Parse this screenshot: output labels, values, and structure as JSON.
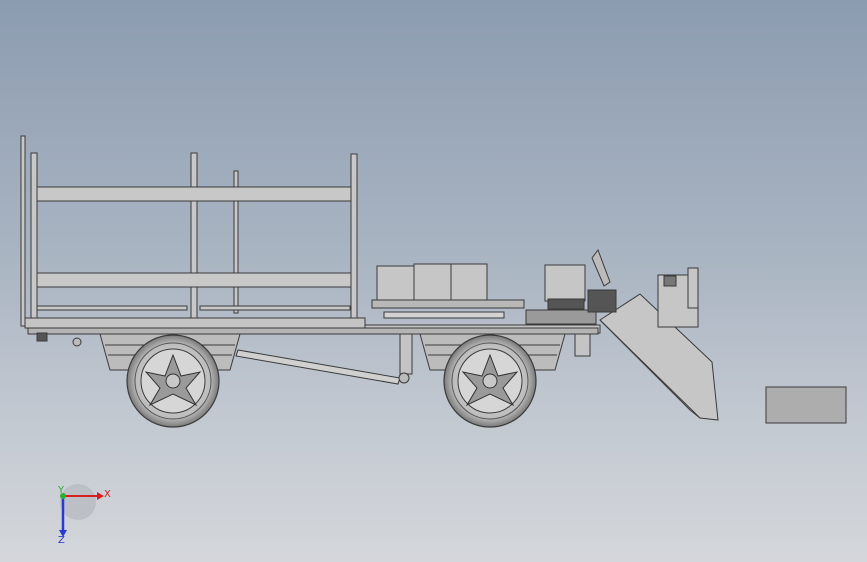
{
  "viewport": {
    "background_top": "#8c9cb0",
    "background_bottom": "#d4d7db"
  },
  "model": {
    "body_color": "#c8c8c8",
    "edge_color": "#3a3a3a"
  },
  "triad": {
    "x_label": "X",
    "y_label": "Y",
    "z_label": "Z",
    "x_color": "#d62020",
    "y_color": "#2eae2e",
    "z_color": "#2a3ad0"
  }
}
